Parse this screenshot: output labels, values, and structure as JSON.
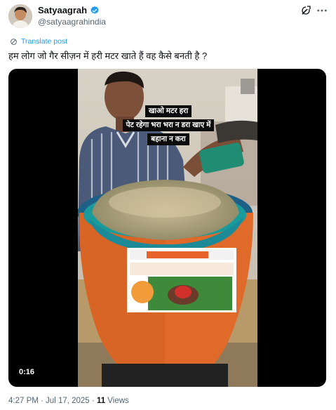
{
  "author": {
    "name": "Satyaagrah",
    "handle": "@satyaagrahindia",
    "verified_icon": "verified-badge-icon",
    "verified_color": "#1d9bf0"
  },
  "header_icons": [
    "grok-icon",
    "more-icon"
  ],
  "translate_label": "Translate post",
  "tweet_text": "हम लोग जो गैर सीज़न में हरी मटर खाते हैं वह कैसे बनती है ?",
  "video": {
    "caption_lines": [
      "खाओ मटर हरा",
      "पेट रहेगा भरा भरा न डरा खाए में",
      "बहाना न करा"
    ],
    "duration": "0:16"
  },
  "meta": {
    "time_date": "4:27 PM · Jul 17, 2025 · ",
    "views_count": "11",
    "views_label": " Views"
  },
  "colors": {
    "accent": "#1d9bf0",
    "text": "#0f1419",
    "secondary": "#536471"
  }
}
